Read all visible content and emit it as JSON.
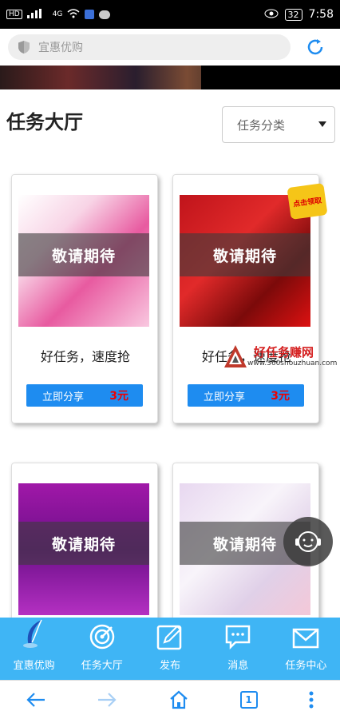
{
  "status_bar": {
    "network_left": "HD",
    "signal_label": "4G",
    "battery": "32",
    "time": "7:58"
  },
  "browser": {
    "url_text": "宜惠优购"
  },
  "page": {
    "title": "任务大厅",
    "category_select": "任务分类"
  },
  "cards": [
    {
      "overlay": "敬请期待",
      "name": "好任务，速度抢",
      "button_label": "立即分享",
      "price": "3元"
    },
    {
      "overlay": "敬请期待",
      "name": "好任务，速度抢",
      "button_label": "立即分享",
      "price": "3元"
    },
    {
      "overlay": "敬请期待"
    },
    {
      "overlay": "敬请期待"
    }
  ],
  "card2_sticker": "点击领取",
  "watermark": {
    "title": "好任务赚网",
    "url": "www.360shouzhuan.com"
  },
  "tabbar": {
    "items": [
      {
        "label": "宜惠优购",
        "icon": "feather-logo-icon"
      },
      {
        "label": "任务大厅",
        "icon": "target-icon"
      },
      {
        "label": "发布",
        "icon": "edit-icon"
      },
      {
        "label": "消息",
        "icon": "message-icon"
      },
      {
        "label": "任务中心",
        "icon": "mail-icon"
      }
    ]
  },
  "bottom_nav": {
    "tab_count": "1"
  },
  "colors": {
    "accent_blue": "#1e8cf0",
    "tabbar_blue": "#3fb5f5",
    "price_red": "#e00000"
  }
}
